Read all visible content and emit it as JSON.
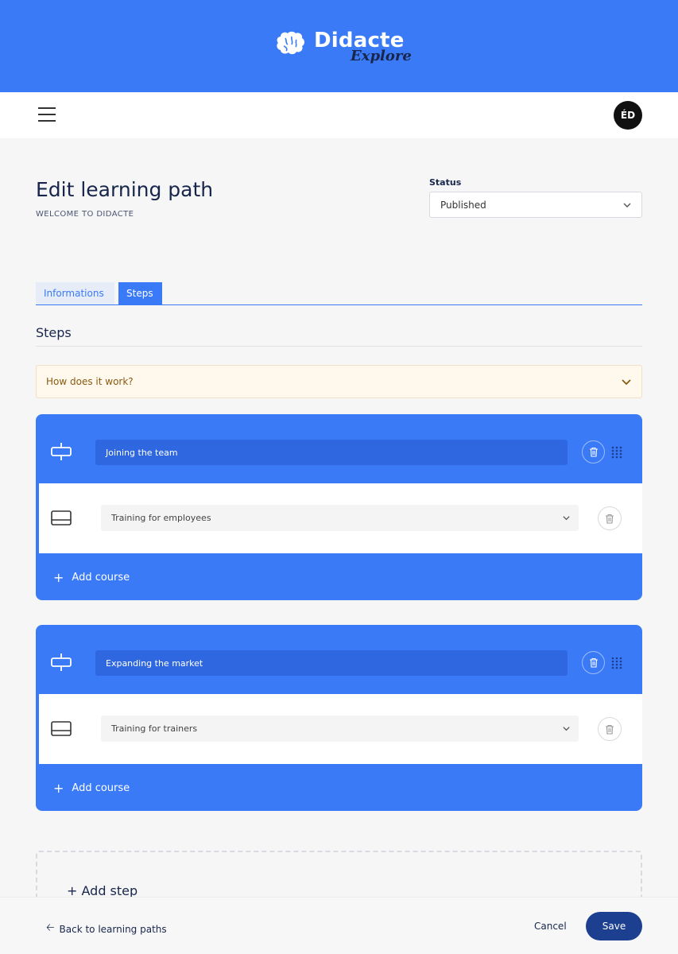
{
  "brand": {
    "name": "Didacte",
    "product": "Explore"
  },
  "user": {
    "initials": "ÉD"
  },
  "header": {
    "title": "Edit learning path",
    "subtitle": "WELCOME TO DIDACTE"
  },
  "status": {
    "label": "Status",
    "value": "Published"
  },
  "tabs": [
    {
      "label": "Informations",
      "active": false
    },
    {
      "label": "Steps",
      "active": true
    }
  ],
  "section": {
    "title": "Steps"
  },
  "help": {
    "label": "How does it work?"
  },
  "steps": [
    {
      "name": "Joining the team",
      "courses": [
        {
          "name": "Training for employees"
        }
      ],
      "add_course_label": "Add course"
    },
    {
      "name": "Expanding the market",
      "courses": [
        {
          "name": "Training for trainers"
        }
      ],
      "add_course_label": "Add course"
    }
  ],
  "add_step_label": "+ Add step",
  "footer": {
    "back_label": "Back to learning paths",
    "cancel_label": "Cancel",
    "save_label": "Save"
  },
  "colors": {
    "primary": "#3a7af7",
    "dark_navy": "#1c3f8f",
    "help_bg": "#fff8ec"
  }
}
